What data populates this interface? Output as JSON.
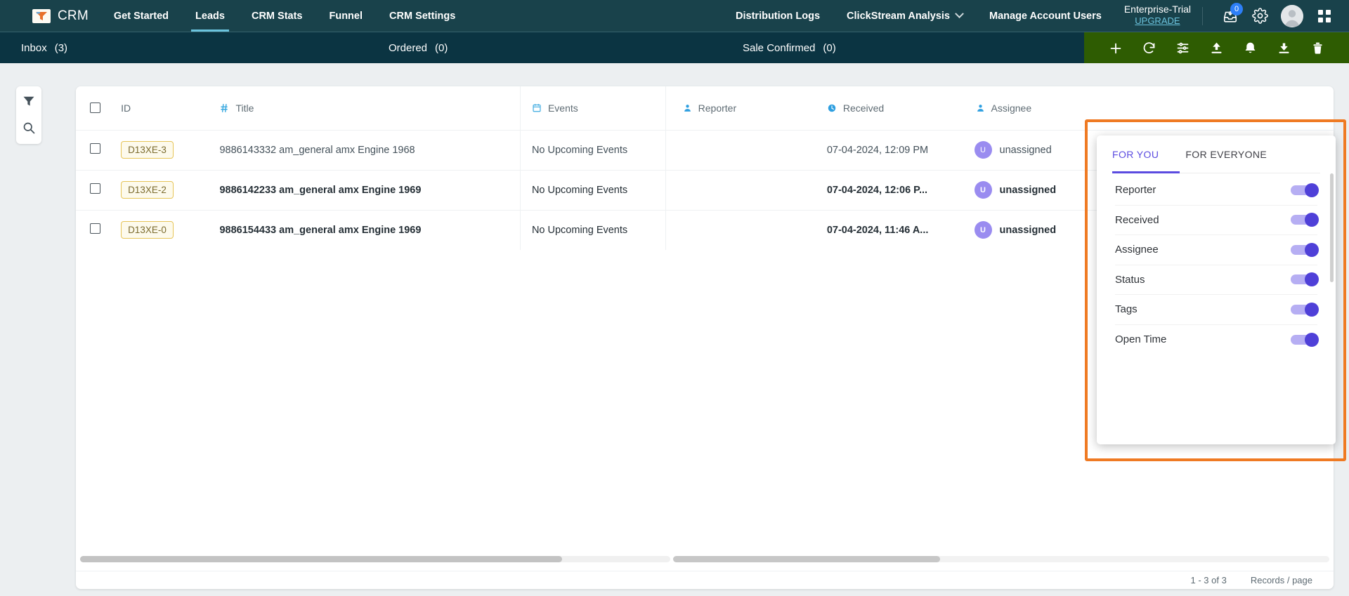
{
  "topnav": {
    "brand": "CRM",
    "brand_icon": "funnel-logo-icon",
    "links": [
      {
        "label": "Get Started",
        "active": false
      },
      {
        "label": "Leads",
        "active": true
      },
      {
        "label": "CRM Stats",
        "active": false
      },
      {
        "label": "Funnel",
        "active": false
      },
      {
        "label": "CRM Settings",
        "active": false
      }
    ],
    "right_links": [
      {
        "label": "Distribution Logs",
        "has_caret": false
      },
      {
        "label": "ClickStream Analysis",
        "has_caret": true
      },
      {
        "label": "Manage Account Users",
        "has_caret": false
      }
    ],
    "plan": {
      "name": "Enterprise-Trial",
      "upgrade": "UPGRADE"
    },
    "inbox_badge": "0",
    "icons": [
      "inbox-download-icon",
      "gear-icon",
      "avatar",
      "apps-grid-icon"
    ]
  },
  "subbar": {
    "tabs": [
      {
        "label": "Inbox",
        "count": "(3)"
      },
      {
        "label": "Ordered",
        "count": "(0)"
      },
      {
        "label": "Sale Confirmed",
        "count": "(0)"
      }
    ],
    "tools": [
      "plus-icon",
      "refresh-icon",
      "column-settings-icon",
      "upload-icon",
      "notification-bell-icon",
      "download-icon",
      "delete-icon"
    ]
  },
  "left_rail": {
    "icons": [
      "filter-icon",
      "search-icon"
    ]
  },
  "table": {
    "columns": [
      {
        "key": "checkbox",
        "label": "",
        "icon": "checkbox-icon"
      },
      {
        "key": "id",
        "label": "ID",
        "icon": ""
      },
      {
        "key": "title",
        "label": "Title",
        "icon": "hash-icon"
      },
      {
        "key": "events",
        "label": "Events",
        "icon": "calendar-icon"
      },
      {
        "key": "reporter",
        "label": "Reporter",
        "icon": "person-icon"
      },
      {
        "key": "received",
        "label": "Received",
        "icon": "clock-icon"
      },
      {
        "key": "assignee",
        "label": "Assignee",
        "icon": "person-icon"
      }
    ],
    "rows": [
      {
        "id": "D13XE-3",
        "title": "9886143332 am_general amx Engine 1968",
        "events": "No Upcoming Events",
        "reporter": "",
        "received": "07-04-2024, 12:09 PM",
        "assignee": "unassigned",
        "assignee_initial": "U",
        "unread": false
      },
      {
        "id": "D13XE-2",
        "title": "9886142233 am_general amx Engine 1969",
        "events": "No Upcoming Events",
        "reporter": "",
        "received": "07-04-2024, 12:06 P...",
        "assignee": "unassigned",
        "assignee_initial": "U",
        "unread": true
      },
      {
        "id": "D13XE-0",
        "title": "9886154433 am_general amx Engine 1969",
        "events": "No Upcoming Events",
        "reporter": "",
        "received": "07-04-2024, 11:46 A...",
        "assignee": "unassigned",
        "assignee_initial": "U",
        "unread": true
      }
    ],
    "footer": {
      "range": "1 - 3 of 3",
      "per_page": "Records / page"
    }
  },
  "dropdown": {
    "tabs": [
      {
        "label": "FOR YOU",
        "active": true
      },
      {
        "label": "FOR EVERYONE",
        "active": false
      }
    ],
    "options": [
      {
        "label": "Reporter",
        "on": true
      },
      {
        "label": "Received",
        "on": true
      },
      {
        "label": "Assignee",
        "on": true
      },
      {
        "label": "Status",
        "on": true
      },
      {
        "label": "Tags",
        "on": true
      },
      {
        "label": "Open Time",
        "on": true
      }
    ]
  },
  "colors": {
    "topnav_bg": "#19424b",
    "subbar_bg": "#0b3442",
    "tools_bg": "#2e5c02",
    "accent_blue": "#6bc3dd",
    "highlight_orange": "#ef7a23",
    "toggle_purple": "#4f40d8",
    "id_chip_border": "#e6c457"
  }
}
